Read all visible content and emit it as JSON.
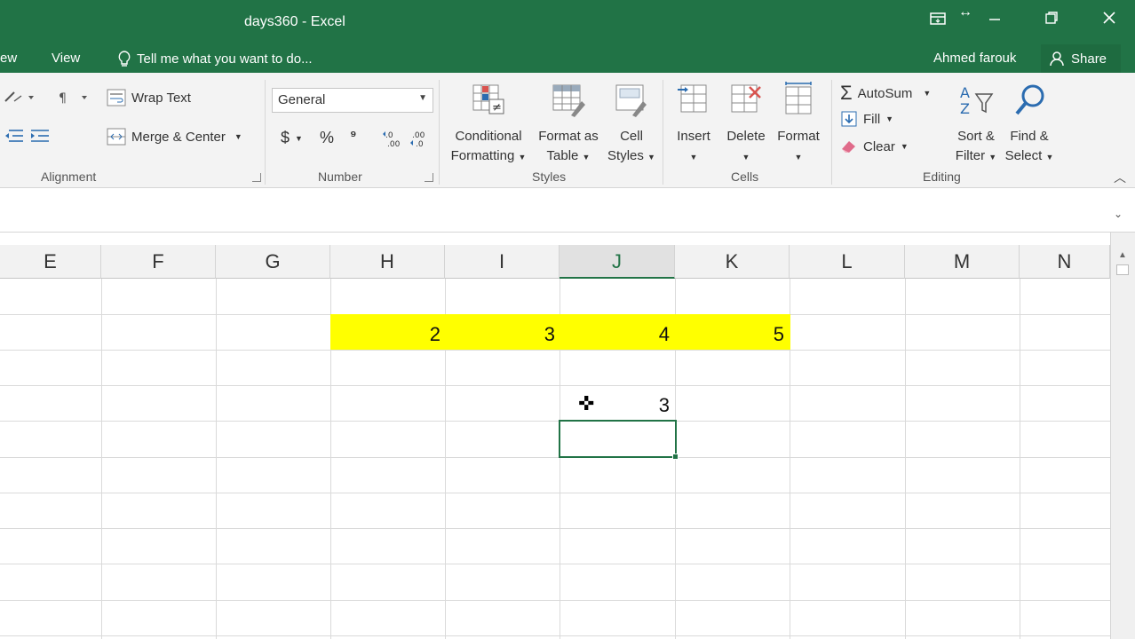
{
  "window": {
    "title": "days360 - Excel",
    "restore_icon": "ribbon-display-icon",
    "minimize_label": "—",
    "maximize_label": "❐",
    "close_label": "✕"
  },
  "tabs": {
    "items": [
      "ew",
      "View"
    ],
    "tell_me": "Tell me what you want to do...",
    "user": "Ahmed farouk",
    "share": "Share"
  },
  "ribbon": {
    "alignment": {
      "label": "Alignment",
      "wrap_text": "Wrap Text",
      "merge_center": "Merge & Center"
    },
    "number": {
      "label": "Number",
      "format": "General",
      "currency": "$",
      "percent": "%",
      "comma": "⁹",
      "inc_decimal": "←.0\n.00",
      "dec_decimal": ".00\n→.0"
    },
    "styles": {
      "label": "Styles",
      "conditional_1": "Conditional",
      "conditional_2": "Formatting",
      "format_table_1": "Format as",
      "format_table_2": "Table",
      "cell_styles_1": "Cell",
      "cell_styles_2": "Styles"
    },
    "cells": {
      "label": "Cells",
      "insert": "Insert",
      "delete": "Delete",
      "format": "Format"
    },
    "editing": {
      "label": "Editing",
      "autosum": "AutoSum",
      "fill": "Fill",
      "clear": "Clear",
      "sort_1": "Sort &",
      "sort_2": "Filter",
      "find_1": "Find &",
      "find_2": "Select"
    }
  },
  "grid": {
    "columns": [
      "E",
      "F",
      "G",
      "H",
      "I",
      "J",
      "K",
      "L",
      "M",
      "N"
    ],
    "selected_column": "J",
    "row2_values": [
      "2",
      "3",
      "4",
      "5"
    ],
    "j4_value": "3"
  }
}
